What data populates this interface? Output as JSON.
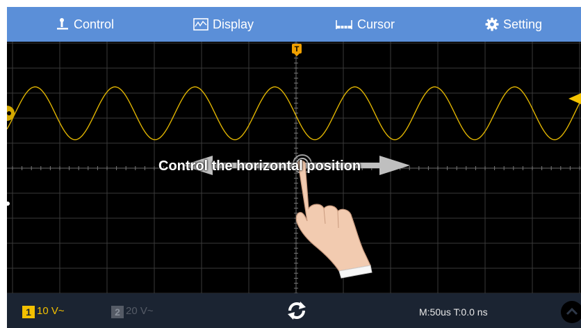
{
  "topbar": {
    "tabs": [
      {
        "label": "Control",
        "icon": "probe-icon"
      },
      {
        "label": "Display",
        "icon": "waveform-display-icon"
      },
      {
        "label": "Cursor",
        "icon": "ruler-cursor-icon"
      },
      {
        "label": "Setting",
        "icon": "gear-icon"
      }
    ]
  },
  "scope": {
    "trigger_marker": "T",
    "overlay_text": "Control the horizontal position",
    "waveform_color": "#e0b400"
  },
  "bottombar": {
    "ch1": {
      "number": "1",
      "scale": "10 V~",
      "color": "#f3c000",
      "active": true
    },
    "ch2": {
      "number": "2",
      "scale": "20 V~",
      "color": "#555b66",
      "active": false
    },
    "timebase": "M:50us  T:0.0 ns",
    "run_icon": "refresh-icon",
    "menu_icon": "chevron-up-icon"
  }
}
